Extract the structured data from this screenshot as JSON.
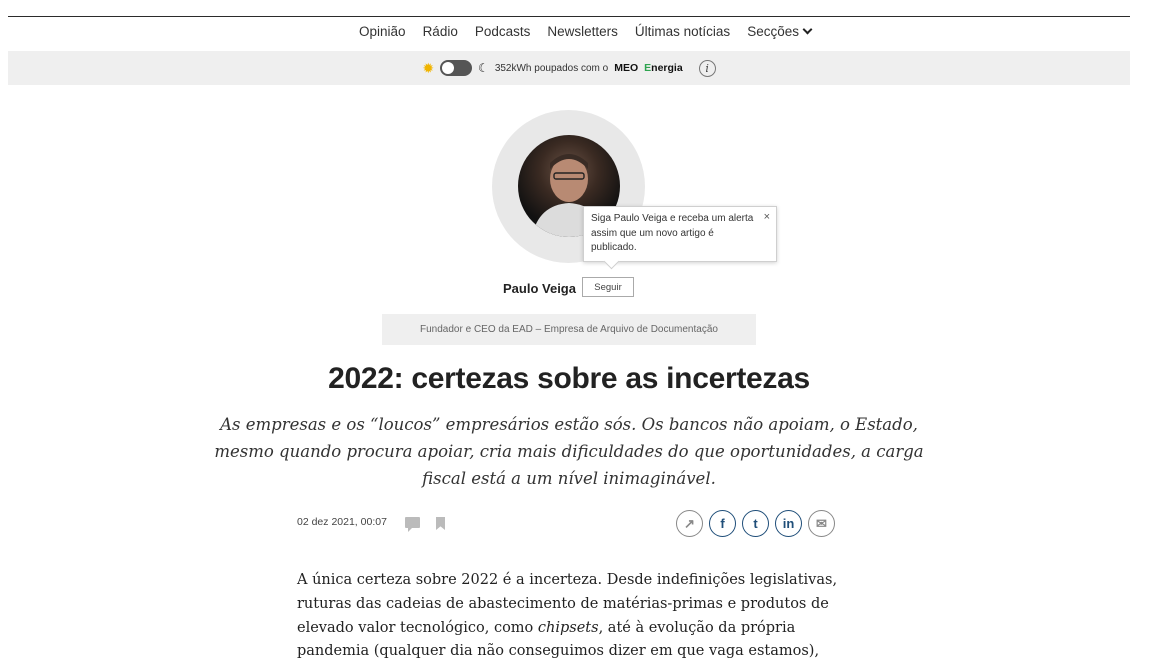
{
  "nav": {
    "items": [
      "Opinião",
      "Rádio",
      "Podcasts",
      "Newsletters",
      "Últimas notícias",
      "Secções"
    ]
  },
  "energy": {
    "saved_text": "352kWh poupados com o",
    "brand_meo": "MEO",
    "brand_energia_e": "E",
    "brand_energia_rest": "nergia",
    "info_label": "i",
    "toggle_on": false
  },
  "author": {
    "tooltip_text": "Siga Paulo Veiga e receba um alerta assim que um novo artigo é publicado.",
    "tooltip_close": "×",
    "name": "Paulo Veiga",
    "follow_label": "Seguir",
    "role": "Fundador e CEO da EAD – Empresa de Arquivo de Documentação"
  },
  "article": {
    "title": "2022: certezas sobre as incertezas",
    "lede": "As empresas e os “loucos” empresários estão sós. Os bancos não apoiam, o Estado, mesmo quando procura apoiar, cria mais dificuldades do que oportunidades, a carga fiscal está a um nível inimaginável.",
    "date": "02 dez 2021, 00:07",
    "body_part1": "A única certeza sobre 2022 é a incerteza. Desde indefinições legislativas, ruturas das cadeias de abastecimento de matérias-primas e produtos de elevado valor tecnológico, como ",
    "body_em": "chipsets",
    "body_part2": ", até à evolução da própria pandemia (qualquer dia não conseguimos dizer em que vaga estamos),"
  },
  "share": {
    "share_glyph": "↗",
    "facebook": "f",
    "twitter": "t",
    "linkedin": "in",
    "email": "✉"
  },
  "colors": {
    "share_blue": "#1f4e79",
    "energia_green": "#2ea44f",
    "sun_yellow": "#f0b400",
    "bar_grey": "#efefef"
  }
}
